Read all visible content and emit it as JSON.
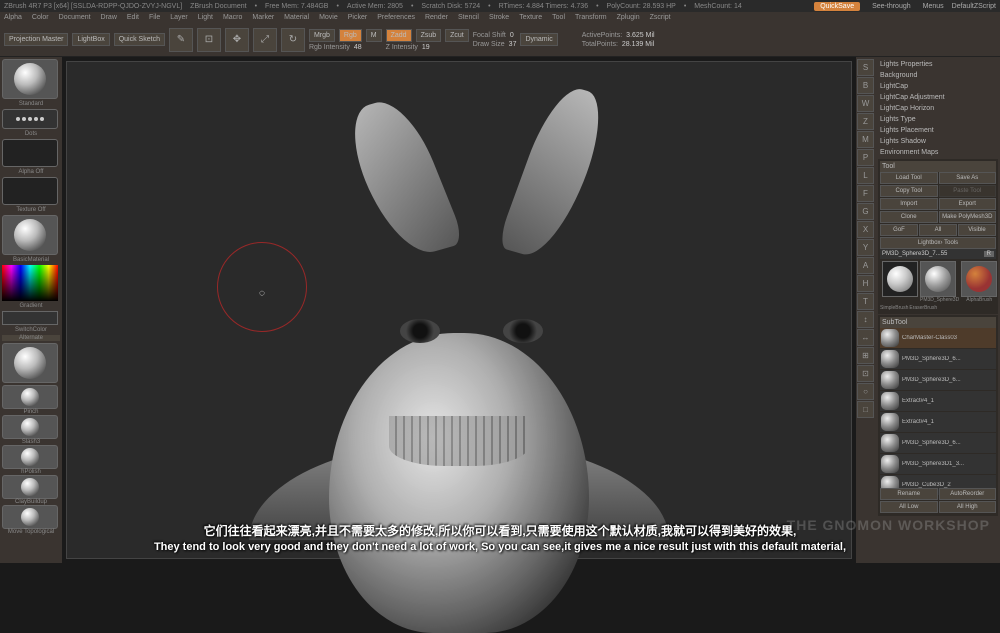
{
  "title_bar": {
    "app": "ZBrush 4R7 P3 [x64] [SSLDA-RDPP-QJDO-ZVYJ-NGVL]",
    "doc": "ZBrush Document",
    "freemem": "Free Mem: 7.484GB",
    "activemem": "Active Mem: 2805",
    "scratch": "Scratch Disk: 5724",
    "rtimes": "RTimes: 4.884 Timers: 4.736",
    "polycount": "PolyCount: 28.593 HP",
    "meshcount": "MeshCount: 14",
    "quicksave": "QuickSave",
    "seethrough": "See-through",
    "menus": "Menus",
    "script": "DefaultZScript"
  },
  "menu": [
    "Alpha",
    "Color",
    "Document",
    "Draw",
    "Edit",
    "File",
    "Layer",
    "Light",
    "Macro",
    "Marker",
    "Material",
    "Movie",
    "Picker",
    "Preferences",
    "Render",
    "Stencil",
    "Stroke",
    "Texture",
    "Tool",
    "Transform",
    "Zplugin",
    "Zscript"
  ],
  "toolbar": {
    "projection": "Projection Master",
    "lightbox": "LightBox",
    "quicksketch": "Quick Sketch",
    "edit": "Edit",
    "draw": "Draw",
    "move": "Move",
    "scale": "Scale",
    "rotate": "Rotate",
    "mrgb": "Mrgb",
    "rgb": "Rgb",
    "m": "M",
    "rgb_intensity_label": "Rgb Intensity",
    "rgb_intensity": "48",
    "zadd": "Zadd",
    "zsub": "Zsub",
    "zcut": "Zcut",
    "z_intensity_label": "Z Intensity",
    "z_intensity": "19",
    "focal_shift_label": "Focal Shift",
    "focal_shift": "0",
    "draw_size_label": "Draw Size",
    "draw_size": "37",
    "dynamic": "Dynamic",
    "active_pts_label": "ActivePoints:",
    "active_pts": "3.625 Mil",
    "total_pts_label": "TotalPoints:",
    "total_pts": "28.139 Mil"
  },
  "left": {
    "brush_label": "Standard",
    "stroke_label": "Dots",
    "alpha_label": "Alpha Off",
    "texture_label": "Texture Off",
    "material_label": "BasicMaterial",
    "gradient": "Gradient",
    "switch": "SwitchColor",
    "alternate": "Alternate",
    "brushes": [
      "Pinch",
      "Slash3",
      "hPolish",
      "ClayBuildup",
      "Move Topological"
    ]
  },
  "right_headers": [
    "Lights Properties",
    "Background",
    "LightCap",
    "LightCap Adjustment",
    "LightCap Horizon",
    "Lights Type",
    "Lights Placement",
    "Lights Shadow",
    "Environment Maps"
  ],
  "tool": {
    "title": "Tool",
    "load": "Load Tool",
    "save": "Save As",
    "copy": "Copy Tool",
    "paste": "Paste Tool",
    "import": "Import",
    "export": "Export",
    "clone": "Clone",
    "make": "Make PolyMesh3D",
    "gof": "GoF",
    "all": "All",
    "visible": "Visible",
    "lbtools": "Lightbox› Tools",
    "current": "PM3D_Sphere3D_7...55",
    "r": "R",
    "thumb1_label": "PM3D_Sphere3D",
    "thumb2_label": "AlphaBrush",
    "simple": "SimpleBrush",
    "eraser": "EraserBrush"
  },
  "subtool": {
    "title": "SubTool",
    "items": [
      "CharMaster-Class03",
      "PM3D_Sphere3D_6...",
      "PM3D_Sphere3D_6...",
      "Extract#4_1",
      "Extract#4_1",
      "PM3D_Sphere3D_6...",
      "PM3D_Sphere3D1_3...",
      "PM3D_Cube3D_2"
    ],
    "rename": "Rename",
    "autoreorder": "AutoReorder",
    "all_low": "All Low",
    "all_high": "All High"
  },
  "mid_right_icons": [
    "S",
    "B",
    "W",
    "Z",
    "M",
    "P",
    "L",
    "F",
    "G",
    "X",
    "Y",
    "A",
    "H",
    "T",
    "↕",
    "↔",
    "⊞",
    "⊡",
    "○",
    "□"
  ],
  "subtitles": {
    "cn": "它们往往看起来漂亮,并且不需要太多的修改,所以你可以看到,只需要使用这个默认材质,我就可以得到美好的效果,",
    "en": "They tend to look very good and they don't need a lot of work, So you can see,it gives me a nice result just with this default material,"
  },
  "watermark": "THE GNOMON WORKSHOP"
}
